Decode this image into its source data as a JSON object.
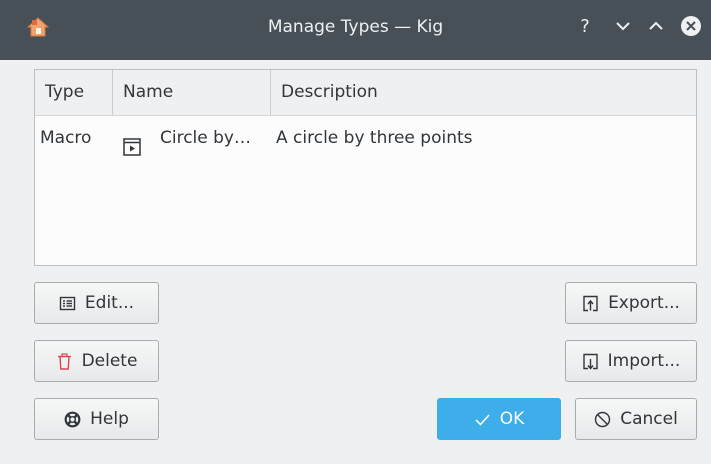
{
  "window": {
    "title": "Manage Types — Kig",
    "controls": {
      "help": "?",
      "minimize": "chevron-down",
      "maximize": "chevron-up",
      "close": "close"
    }
  },
  "table": {
    "headers": [
      "Type",
      "Name",
      "Description"
    ],
    "rows": [
      {
        "type": "Macro",
        "name": "Circle by…",
        "description": "A circle by three points",
        "icon": "macro-icon"
      }
    ]
  },
  "buttons": {
    "edit": "Edit...",
    "delete": "Delete",
    "help": "Help",
    "export": "Export...",
    "import": "Import...",
    "ok": "OK",
    "cancel": "Cancel"
  },
  "colors": {
    "titlebar": "#475057",
    "accent": "#3daee9",
    "delete_icon": "#da4453"
  }
}
